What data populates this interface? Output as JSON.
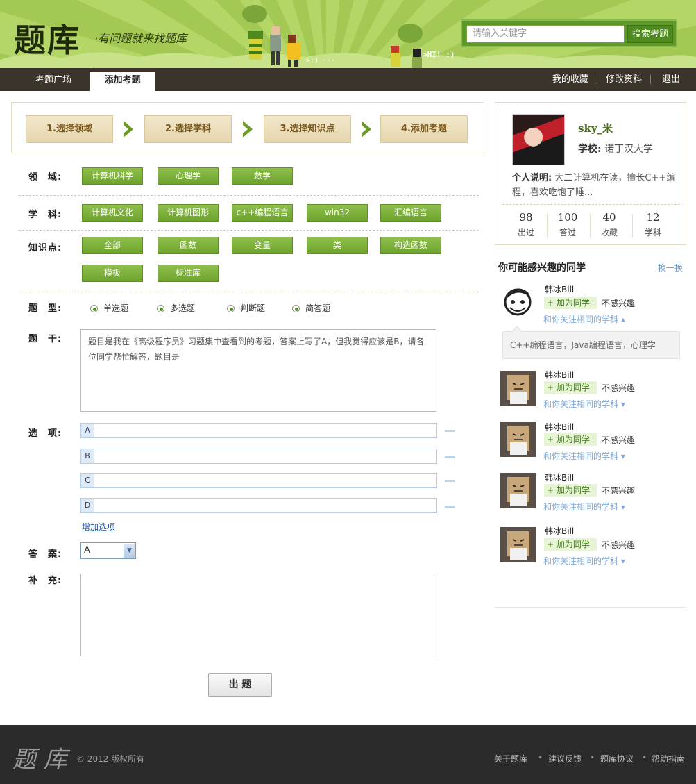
{
  "header": {
    "logo": "题库",
    "slogan": "·有问题就来找题库",
    "search_placeholder": "请输入关键字",
    "search_button": "搜索考题"
  },
  "nav": {
    "tabs": [
      {
        "label": "考题广场"
      },
      {
        "label": "添加考题"
      }
    ],
    "right": [
      {
        "label": "我的收藏"
      },
      {
        "label": "修改资料"
      },
      {
        "label": "退出"
      }
    ]
  },
  "steps": [
    {
      "label": "1.选择领域"
    },
    {
      "label": "2.选择学科"
    },
    {
      "label": "3.选择知识点"
    },
    {
      "label": "4.添加考题"
    }
  ],
  "form": {
    "domain_label": "领　域:",
    "domains": [
      "计算机科学",
      "心理学",
      "数学"
    ],
    "subject_label": "学　科:",
    "subjects": [
      "计算机文化",
      "计算机图形",
      "c++编程语言",
      "win32",
      "汇编语言"
    ],
    "knowledge_label": "知识点:",
    "knowledge": [
      "全部",
      "函数",
      "变量",
      "类",
      "构造函数",
      "模板",
      "标准库"
    ],
    "type_label": "题　型:",
    "types": [
      "单选题",
      "多选题",
      "判断题",
      "简答题"
    ],
    "stem_label": "题　干:",
    "stem_text": "题目是我在《高级程序员》习题集中查看到的考题，答案上写了A，但我觉得应该是B，请各位同学帮忙解答，题目是",
    "options_label": "选　项:",
    "options": [
      "A",
      "B",
      "C",
      "D"
    ],
    "add_option": "增加选项",
    "answer_label": "答　案:",
    "answer_value": "A",
    "supplement_label": "补　充:",
    "submit": "出 题"
  },
  "profile": {
    "name": "sky_米",
    "school_label": "学校:",
    "school": "诺丁汉大学",
    "desc_label": "个人说明:",
    "desc": "大二计算机在读，擅长C++编程，喜欢吃饱了睡...",
    "stats": [
      {
        "num": "98",
        "label": "出过"
      },
      {
        "num": "100",
        "label": "答过"
      },
      {
        "num": "40",
        "label": "收藏"
      },
      {
        "num": "12",
        "label": "学科"
      }
    ]
  },
  "recommend": {
    "title": "你可能感兴趣的同学",
    "refresh": "换一换",
    "add_label": "+ 加为同学",
    "not_interested": "不感兴趣",
    "same_subjects_up": "和你关注相同的学科 ▴",
    "same_subjects_down": "和你关注相同的学科 ▾",
    "bubble": "C++编程语言，Java编程语言，心理学",
    "users": [
      {
        "name": "韩冰Bill"
      },
      {
        "name": "韩冰Bill"
      },
      {
        "name": "韩冰Bill"
      },
      {
        "name": "韩冰Bill"
      },
      {
        "name": "韩冰Bill"
      }
    ]
  },
  "footer": {
    "logo": "题 库",
    "copyright": "© 2012  版权所有",
    "links": [
      "关于题库",
      "建议反馈",
      "题库协议",
      "帮助指南"
    ]
  }
}
